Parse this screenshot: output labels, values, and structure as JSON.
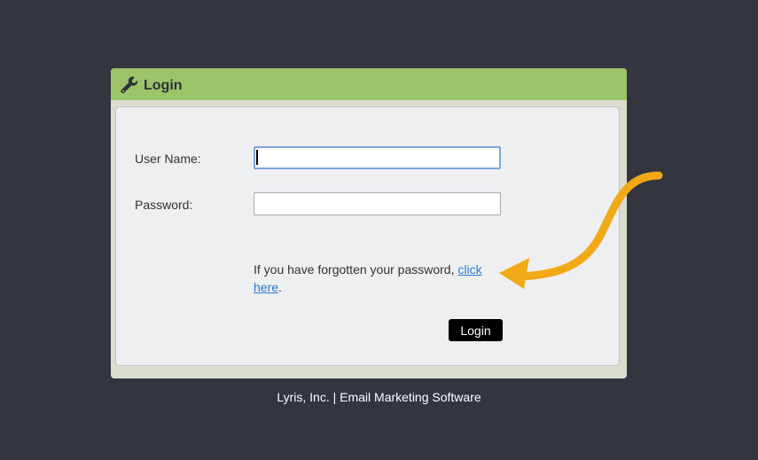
{
  "panel": {
    "title": "Login",
    "icon": "wrench-icon"
  },
  "form": {
    "username_label": "User Name:",
    "username_value": "",
    "password_label": "Password:",
    "password_value": "",
    "forgot_prefix": "If you have forgotten your password, ",
    "forgot_link": "click here",
    "forgot_suffix": ".",
    "login_button": "Login"
  },
  "footer": {
    "text": "Lyris, Inc. | Email Marketing Software"
  },
  "annotation": {
    "arrow_color": "#f2a916",
    "points_to": "forgot-password-link"
  },
  "colors": {
    "background": "#33363f",
    "header": "#9cc469",
    "panel_frame": "#dcdccf",
    "panel_body": "#eeeff1",
    "link": "#2a7ad4"
  }
}
